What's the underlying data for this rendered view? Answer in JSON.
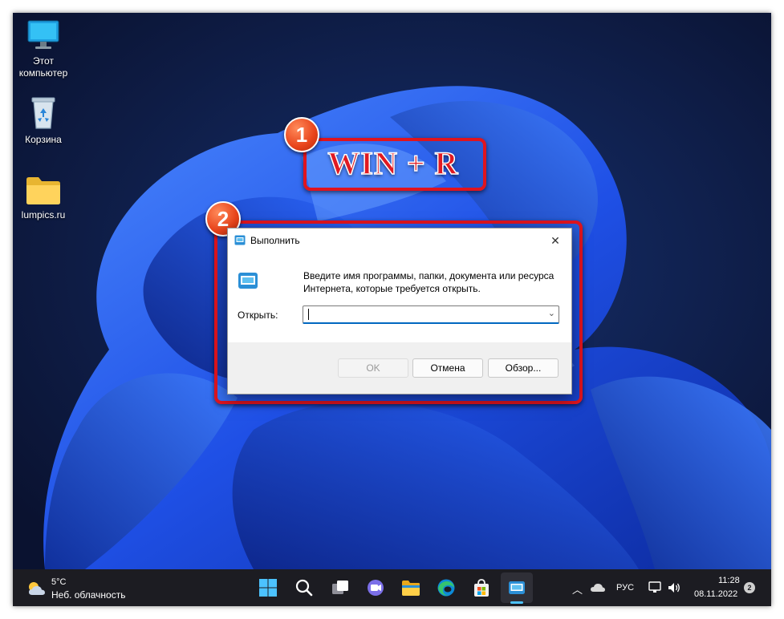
{
  "desktop": {
    "icons": [
      {
        "label": "Этот\nкомпьютер",
        "line1": "Этот",
        "line2": "компьютер"
      },
      {
        "label": "Корзина"
      },
      {
        "label": "lumpics.ru"
      }
    ]
  },
  "annotations": {
    "step1_badge": "1",
    "step1_text": "WIN + R",
    "step2_badge": "2",
    "color": "#e0141e"
  },
  "run_dialog": {
    "title": "Выполнить",
    "close_glyph": "✕",
    "description": "Введите имя программы, папки, документа или ресурса Интернета, которые требуется открыть.",
    "open_label": "Открыть:",
    "input_value": "",
    "dropdown_glyph": "⌄",
    "buttons": {
      "ok": "OK",
      "cancel": "Отмена",
      "browse": "Обзор..."
    }
  },
  "taskbar": {
    "weather_temp": "5°C",
    "weather_desc": "Неб. облачность",
    "icons": [
      "windows-start-icon",
      "search-icon",
      "task-view-icon",
      "teams-chat-icon",
      "file-explorer-icon",
      "edge-icon",
      "store-icon",
      "run-app-icon"
    ],
    "tray": {
      "language": "РУС",
      "time": "11:28",
      "date": "08.11.2022",
      "notifications": "2"
    },
    "accent": "#4cc2ff"
  }
}
